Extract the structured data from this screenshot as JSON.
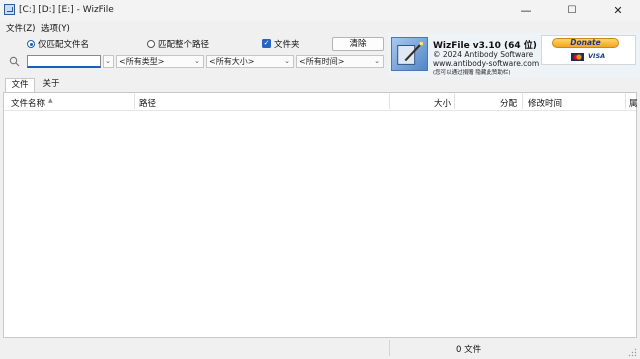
{
  "window": {
    "title": "[C:] [D:] [E:]  -  WizFile",
    "minimize_glyph": "—",
    "maximize_glyph": "☐",
    "close_glyph": "✕",
    "icon": "wizfile-app-icon"
  },
  "menu": {
    "file": "文件(Z)",
    "options": "选项(Y)"
  },
  "search_options": {
    "match_filename_only": "仅匹配文件名",
    "match_full_path": "匹配整个路径",
    "folders": "文件夹",
    "folders_checked": "✓",
    "clear_button": "清除"
  },
  "filters": {
    "search_value": "",
    "type": "<所有类型>",
    "size": "<所有大小>",
    "time": "<所有时间>",
    "chevron": "⌄"
  },
  "banner": {
    "product": "WizFile v3.10 (64 位)",
    "copyright": "© 2024 Antibody Software",
    "website": "www.antibody-software.com",
    "note": "(您可以通过捐赠 隐藏此赞助栏)",
    "donate_label": "Donate",
    "visa_label": "VISA"
  },
  "tabs": {
    "files": "文件",
    "about": "关于"
  },
  "columns": {
    "name": "文件名称",
    "sort_indicator": "▲",
    "path": "路径",
    "size": "大小",
    "alloc": "分配",
    "modified": "修改时间",
    "truncated": "属"
  },
  "status": {
    "count": "0 文件"
  },
  "colors": {
    "accent": "#1a5fb4",
    "checkbox": "#2864c5",
    "donate": "#f5a623"
  }
}
